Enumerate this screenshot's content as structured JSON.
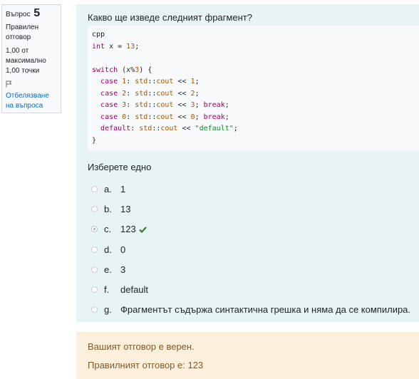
{
  "info": {
    "question_label": "Въпрос",
    "question_number": "5",
    "state": "Правилен отговор",
    "grade_line1": "1,00 от",
    "grade_line2": "максимално",
    "grade_line3": "1,00 точки",
    "flag_label": "Отбелязване на въпроса"
  },
  "question": {
    "text": "Какво ще изведе следният фрагмент?",
    "code_lang": "cpp",
    "prompt": "Изберете едно"
  },
  "answers": [
    {
      "letter": "a.",
      "text": "1",
      "selected": false
    },
    {
      "letter": "b.",
      "text": "13",
      "selected": false
    },
    {
      "letter": "c.",
      "text": "123",
      "selected": true,
      "correct": true
    },
    {
      "letter": "d.",
      "text": "0",
      "selected": false
    },
    {
      "letter": "e.",
      "text": "3",
      "selected": false
    },
    {
      "letter": "f.",
      "text": "default",
      "selected": false
    },
    {
      "letter": "g.",
      "text": "Фрагментът съдържа синтактична грешка и няма да се компилира.",
      "selected": false
    }
  ],
  "feedback": {
    "result": "Вашият отговор е верен.",
    "right_answer": "Правилният отговор е: 123"
  },
  "colors": {
    "formulation_bg": "#e7f3f5",
    "outcome_bg": "#fcefdc",
    "correct_icon": "#357a32",
    "link": "#0f6cbf"
  }
}
